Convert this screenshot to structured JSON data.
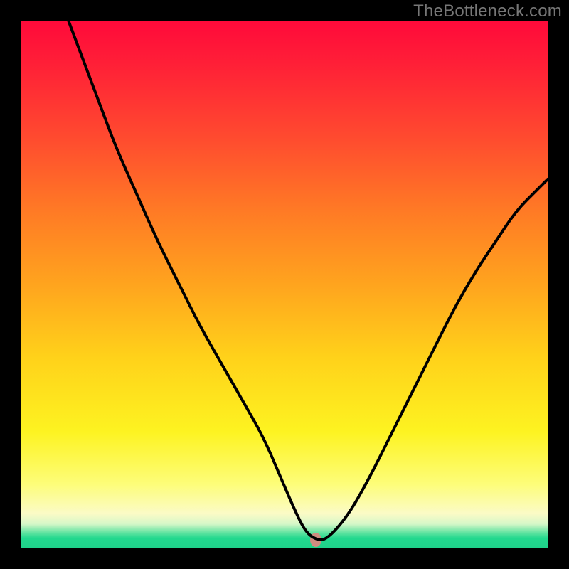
{
  "watermark": "TheBottleneck.com",
  "chart_data": {
    "type": "line",
    "title": "",
    "xlabel": "",
    "ylabel": "",
    "xlim": [
      0,
      100
    ],
    "ylim": [
      0,
      100
    ],
    "grid": false,
    "legend": false,
    "note": "V-shaped bottleneck curve; minimum marked by dot; no visible axis ticks (axes are black frame).",
    "series": [
      {
        "name": "bottleneck-curve",
        "x": [
          9,
          12,
          15,
          18,
          22,
          26,
          30,
          34,
          38,
          42,
          46,
          49,
          52,
          54,
          56,
          58,
          62,
          66,
          70,
          74,
          78,
          82,
          86,
          90,
          94,
          98,
          100
        ],
        "y": [
          100,
          92,
          84,
          76,
          67,
          58,
          50,
          42,
          35,
          28,
          21,
          14,
          7,
          3,
          1.5,
          1.5,
          6,
          13,
          21,
          29,
          37,
          45,
          52,
          58,
          64,
          68,
          70
        ]
      }
    ],
    "marker": {
      "name": "optimal-point",
      "x": 56,
      "y": 1.5,
      "color": "#cf8d80"
    },
    "background_gradient": {
      "orientation": "vertical",
      "stops": [
        {
          "pos": 0.0,
          "color": "#ff0a3a"
        },
        {
          "pos": 0.5,
          "color": "#ffa41e"
        },
        {
          "pos": 0.78,
          "color": "#fdf321"
        },
        {
          "pos": 0.94,
          "color": "#fbfbc6"
        },
        {
          "pos": 0.98,
          "color": "#22d88e"
        },
        {
          "pos": 1.0,
          "color": "#1fd28a"
        }
      ]
    }
  }
}
